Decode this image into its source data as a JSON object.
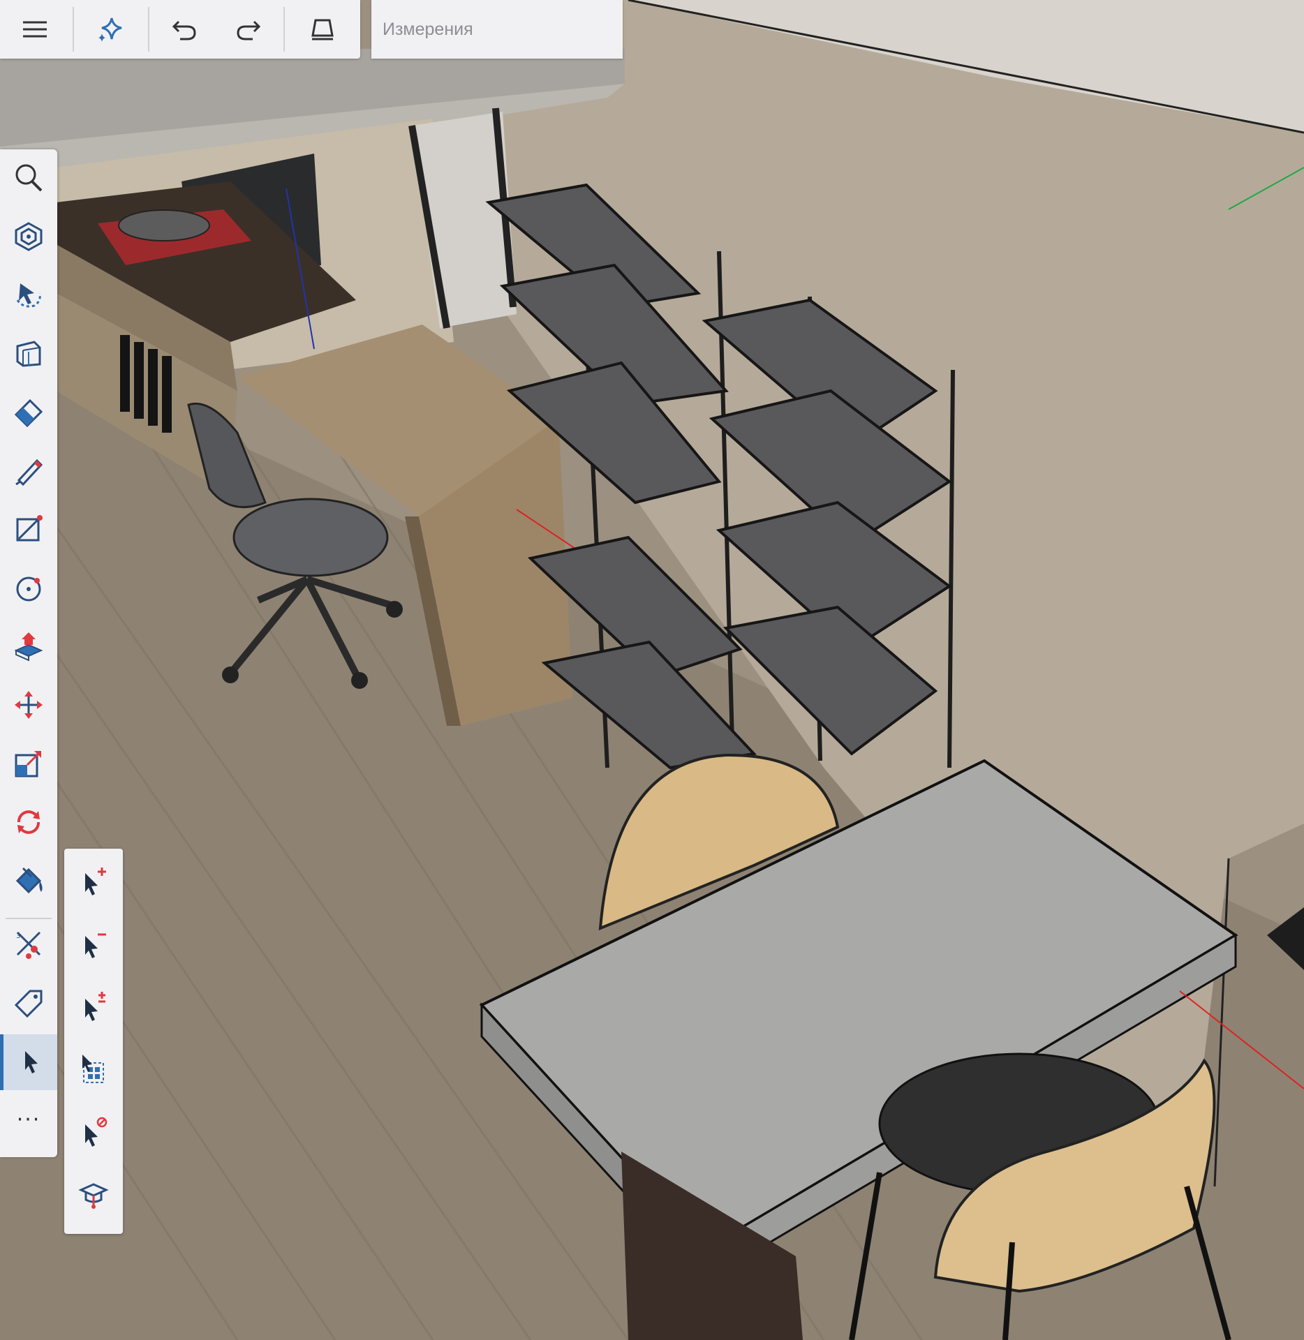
{
  "topbar": {
    "menu_icon": "hamburger-menu-icon",
    "ai_icon": "sparkle-icon",
    "undo_icon": "undo-icon",
    "redo_icon": "redo-icon",
    "display_icon": "display-mode-icon"
  },
  "measurements": {
    "placeholder": "Измерения",
    "value": ""
  },
  "tools": [
    {
      "id": "search",
      "icon": "magnifier-icon"
    },
    {
      "id": "components",
      "icon": "component-icon"
    },
    {
      "id": "orbit",
      "icon": "orbit-icon"
    },
    {
      "id": "sections",
      "icon": "section-box-icon"
    },
    {
      "id": "eraser",
      "icon": "eraser-icon"
    },
    {
      "id": "pencil",
      "icon": "pencil-icon"
    },
    {
      "id": "line",
      "icon": "line-tool-icon"
    },
    {
      "id": "circle",
      "icon": "circle-tool-icon"
    },
    {
      "id": "push-pull",
      "icon": "push-pull-icon"
    },
    {
      "id": "move",
      "icon": "move-icon"
    },
    {
      "id": "scale",
      "icon": "scale-icon"
    },
    {
      "id": "rotate",
      "icon": "rotate-icon"
    },
    {
      "id": "paint",
      "icon": "paint-bucket-icon"
    },
    {
      "id": "tape-measure",
      "icon": "tape-measure-icon"
    },
    {
      "id": "tag",
      "icon": "tag-icon"
    },
    {
      "id": "select",
      "icon": "select-arrow-icon",
      "active": true
    },
    {
      "id": "more",
      "label": "···"
    }
  ],
  "select_modes": [
    {
      "id": "add",
      "icon": "select-add-icon"
    },
    {
      "id": "subtract",
      "icon": "select-subtract-icon"
    },
    {
      "id": "toggle",
      "icon": "select-toggle-icon"
    },
    {
      "id": "select-all",
      "icon": "select-all-icon"
    },
    {
      "id": "select-none",
      "icon": "select-none-icon"
    },
    {
      "id": "learn",
      "icon": "graduation-cap-icon"
    }
  ],
  "colors": {
    "accent_blue": "#2f6fb3",
    "accent_red": "#e0393e",
    "panel_bg": "#f1f1f4",
    "active_bg": "#d2dde9"
  }
}
